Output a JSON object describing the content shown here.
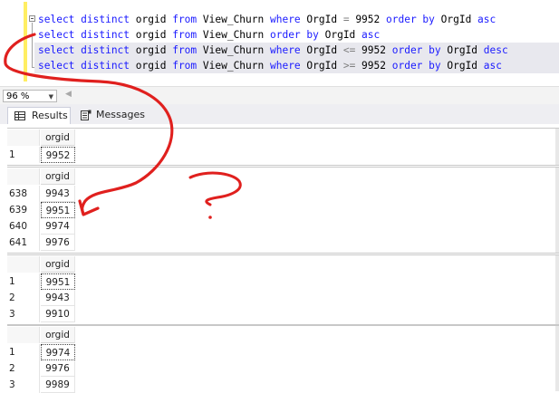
{
  "editor": {
    "lines": [
      {
        "k1": "select distinct",
        "t1": " orgid ",
        "k2": "from",
        "t2": " View_Churn ",
        "k3": "where",
        "t3": " OrgId ",
        "o": "=",
        "t4": " 9952 ",
        "k4": "order by",
        "t5": " OrgId ",
        "k5": "asc"
      },
      {
        "k1": "select distinct",
        "t1": " orgid ",
        "k2": "from",
        "t2": " View_Churn ",
        "k3": "order by",
        "t3": " OrgId ",
        "k4": "asc"
      },
      {
        "k1": "select distinct",
        "t1": " orgid ",
        "k2": "from",
        "t2": " View_Churn ",
        "k3": "where",
        "t3": " OrgId ",
        "o": "<=",
        "t4": " 9952 ",
        "k4": "order by",
        "t5": " OrgId ",
        "k5": "desc"
      },
      {
        "k1": "select distinct",
        "t1": " orgid ",
        "k2": "from",
        "t2": " View_Churn ",
        "k3": "where",
        "t3": " OrgId ",
        "o": ">=",
        "t4": " 9952 ",
        "k4": "order by",
        "t5": " OrgId ",
        "k5": "asc"
      }
    ]
  },
  "zoom": {
    "value": "96 %"
  },
  "tabs": {
    "results": "Results",
    "messages": "Messages"
  },
  "grids": [
    {
      "column": "orgid",
      "rows": [
        {
          "n": "1",
          "v": "9952"
        }
      ]
    },
    {
      "column": "orgid",
      "rows": [
        {
          "n": "638",
          "v": "9943"
        },
        {
          "n": "639",
          "v": "9951"
        },
        {
          "n": "640",
          "v": "9974"
        },
        {
          "n": "641",
          "v": "9976"
        }
      ]
    },
    {
      "column": "orgid",
      "rows": [
        {
          "n": "1",
          "v": "9951"
        },
        {
          "n": "2",
          "v": "9943"
        },
        {
          "n": "3",
          "v": "9910"
        }
      ]
    },
    {
      "column": "orgid",
      "rows": [
        {
          "n": "1",
          "v": "9974"
        },
        {
          "n": "2",
          "v": "9976"
        },
        {
          "n": "3",
          "v": "9989"
        }
      ]
    }
  ],
  "colors": {
    "keyword": "#1a1aff",
    "operator": "#808080",
    "annotation": "#e0201e"
  }
}
